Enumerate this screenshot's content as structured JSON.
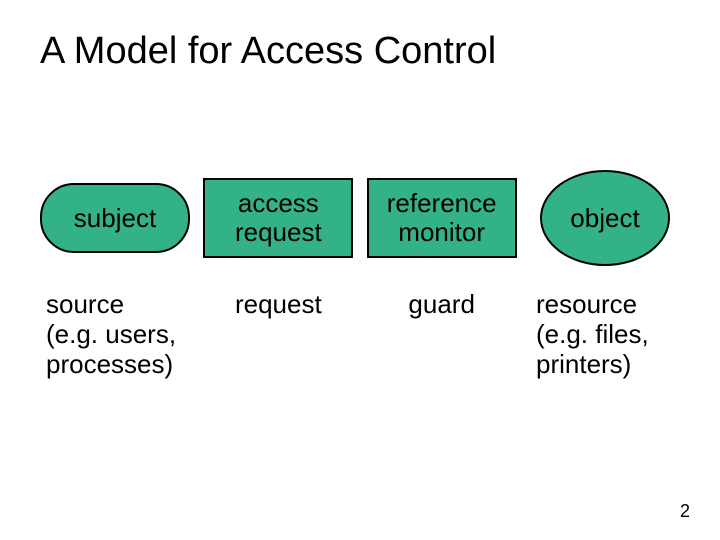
{
  "title": "A Model for Access Control",
  "shapes": {
    "subject": "subject",
    "access_request": "access\nrequest",
    "reference_monitor": "reference\nmonitor",
    "object": "object"
  },
  "labels": {
    "source": "source\n(e.g. users,\nprocesses)",
    "request": "request",
    "guard": "guard",
    "resource": "resource\n(e.g. files,\nprinters)"
  },
  "page_number": "2",
  "colors": {
    "fill": "#33b28a"
  }
}
